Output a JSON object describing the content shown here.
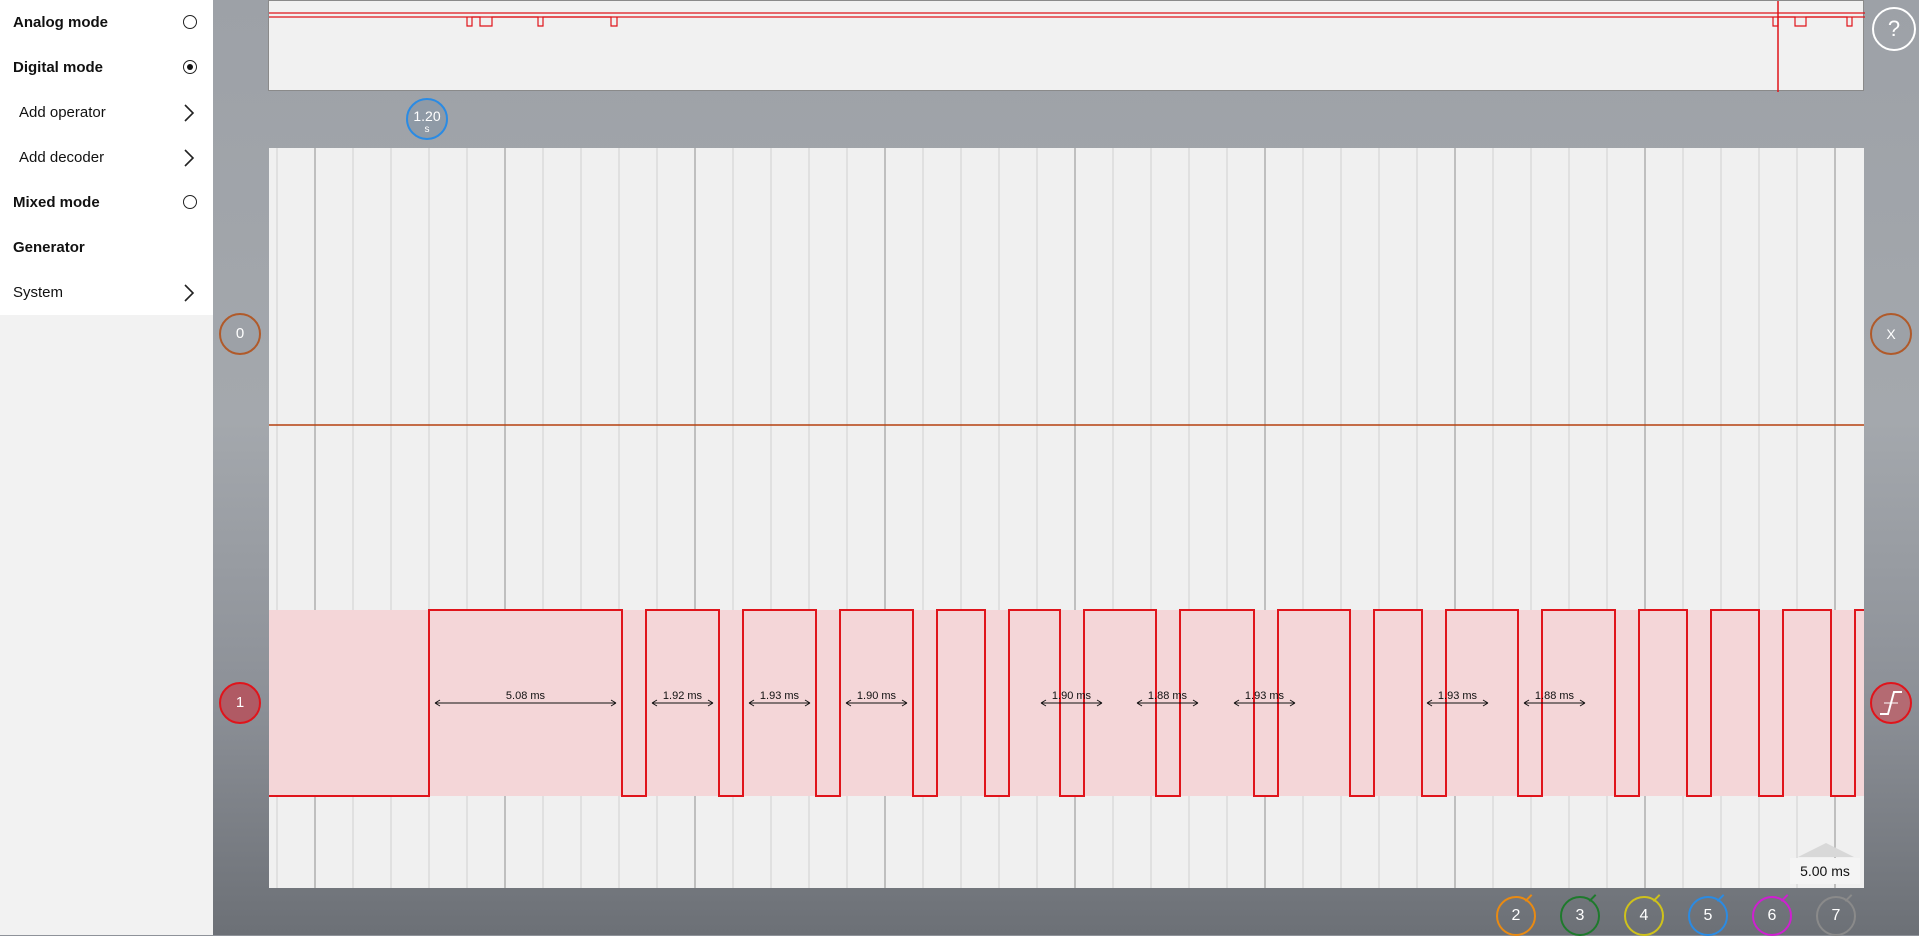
{
  "menu": {
    "analog_mode": "Analog mode",
    "digital_mode": "Digital mode",
    "add_operator": "Add operator",
    "add_decoder": "Add decoder",
    "mixed_mode": "Mixed mode",
    "generator": "Generator",
    "system": "System",
    "selected_mode": "Digital mode"
  },
  "help_label": "?",
  "time_marker": {
    "value": "1.20",
    "unit": "s"
  },
  "channels": {
    "ch0_label": "0",
    "ch0_right_label": "X",
    "ch1_label": "1",
    "ch0_color": "#b5410f",
    "ch1_color": "#e0141b"
  },
  "timebase": "5.00 ms",
  "knobs": [
    {
      "label": "2",
      "color": "#e98a12"
    },
    {
      "label": "3",
      "color": "#1e7a2c"
    },
    {
      "label": "4",
      "color": "#cfc21a"
    },
    {
      "label": "5",
      "color": "#2a8be4"
    },
    {
      "label": "6",
      "color": "#cf1fd1"
    },
    {
      "label": "7",
      "color": "#8a8a8a"
    }
  ],
  "measurements": [
    "5.08 ms",
    "1.92 ms",
    "1.93 ms",
    "1.90 ms",
    "1.90 ms",
    "1.88 ms",
    "1.93 ms",
    "1.93 ms",
    "1.88 ms"
  ],
  "icons": {
    "radio_off": "radio-empty",
    "radio_on": "radio-filled",
    "chevron": "chevron-right",
    "trigger": "rising-edge-trigger"
  }
}
